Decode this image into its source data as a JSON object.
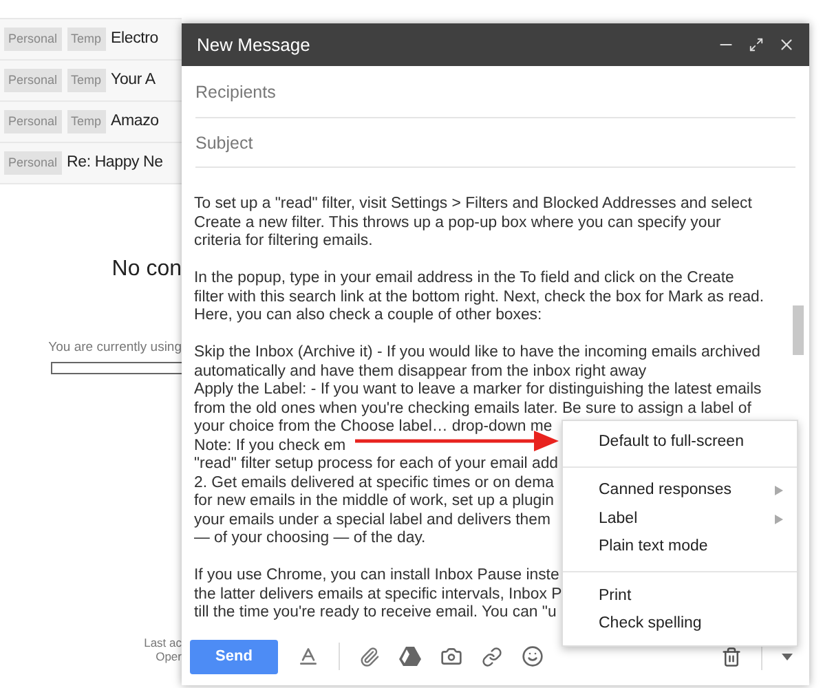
{
  "inbox": {
    "rows": [
      {
        "labels": [
          "Personal",
          "Temp"
        ],
        "subject": "Electro"
      },
      {
        "labels": [
          "Personal",
          "Temp"
        ],
        "subject": "Your A"
      },
      {
        "labels": [
          "Personal",
          "Temp"
        ],
        "subject": "Amazo"
      },
      {
        "labels": [
          "Personal"
        ],
        "subject": "Re: Happy Ne"
      }
    ],
    "empty_title": "No con",
    "usage_text": "You are currently using",
    "activity": [
      "Last ac",
      "Oper"
    ]
  },
  "compose": {
    "title": "New Message",
    "recipients": {
      "placeholder": "Recipients"
    },
    "subject": {
      "placeholder": "Subject"
    },
    "body": [
      [
        "To set up a \"read\" filter, visit Settings > Filters and Blocked Addresses and select",
        "Create a new filter. This throws up a pop-up box where you can specify your",
        "criteria for filtering emails."
      ],
      [
        "In the popup, type in your email address in the To field and click on the Create",
        "filter with this search link at the bottom right. Next, check the box for Mark as read.",
        "Here, you can also check a couple of other boxes:"
      ],
      [
        "Skip the Inbox (Archive it) - If you would like to have the incoming emails archived",
        "automatically and have them disappear from the inbox right away",
        "Apply the Label: - If you want to leave a marker for distinguishing the latest emails",
        "from the old ones when you're checking emails later. Be sure to assign a label of",
        "your choice from the Choose label… drop-down me",
        "Note: If you check em",
        "\"read\" filter setup process for each of your email add",
        "2. Get emails delivered at specific times or on dema",
        "for new emails in the middle of work, set up a plugin",
        "your emails under a special label and delivers them",
        "— of your choosing — of the day."
      ],
      [
        "If you use Chrome, you can install Inbox Pause inste",
        "the latter delivers emails at specific intervals, Inbox P",
        "till the time you're ready to receive email. You can \"u"
      ]
    ],
    "send": "Send",
    "menu": [
      [
        {
          "label": "Default to full-screen",
          "submenu": false
        }
      ],
      [
        {
          "label": "Canned responses",
          "submenu": true
        },
        {
          "label": "Label",
          "submenu": true
        },
        {
          "label": "Plain text mode",
          "submenu": false
        }
      ],
      [
        {
          "label": "Print",
          "submenu": false
        },
        {
          "label": "Check spelling",
          "submenu": false
        }
      ]
    ]
  }
}
